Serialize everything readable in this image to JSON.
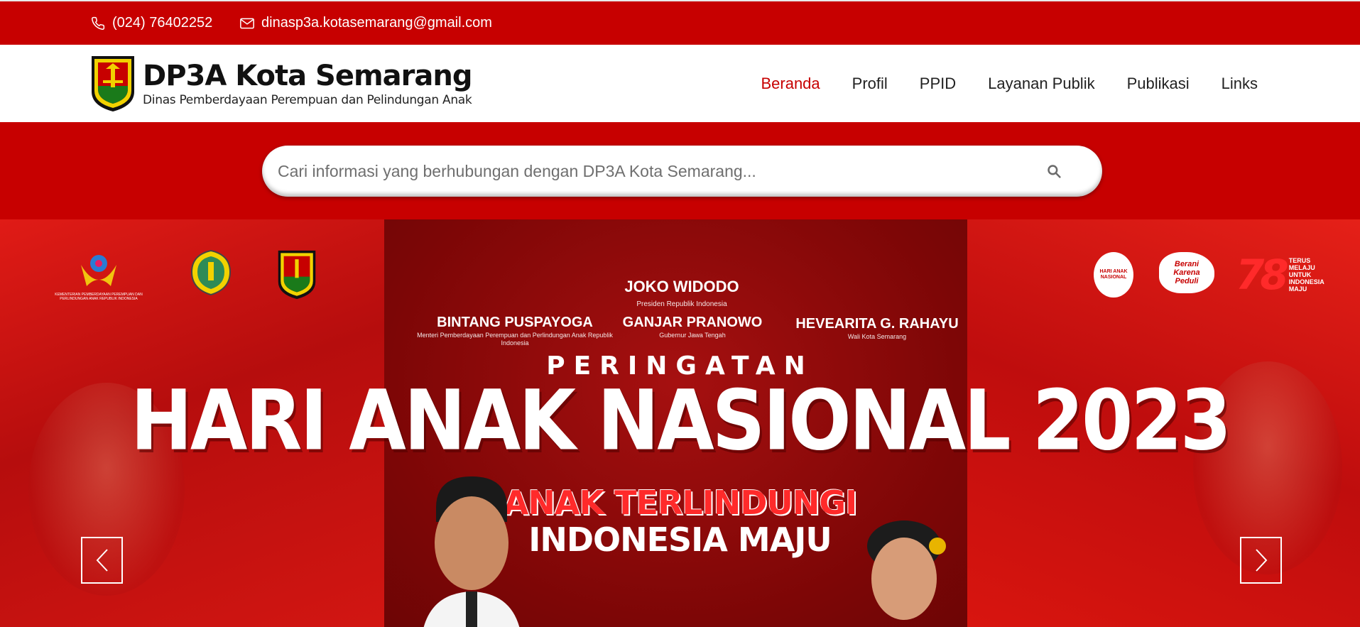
{
  "topbar": {
    "phone": "(024) 76402252",
    "email": "dinasp3a.kotasemarang@gmail.com",
    "phone_icon": "phone-icon",
    "email_icon": "envelope-icon"
  },
  "header": {
    "title": "DP3A Kota Semarang",
    "subtitle": "Dinas Pemberdayaan Perempuan dan Pelindungan Anak"
  },
  "nav": {
    "items": [
      {
        "label": "Beranda",
        "active": true
      },
      {
        "label": "Profil",
        "active": false
      },
      {
        "label": "PPID",
        "active": false
      },
      {
        "label": "Layanan Publik",
        "active": false
      },
      {
        "label": "Publikasi",
        "active": false
      },
      {
        "label": "Links",
        "active": false
      }
    ]
  },
  "search": {
    "placeholder": "Cari informasi yang berhubungan dengan DP3A Kota Semarang...",
    "value": "",
    "icon": "search-icon"
  },
  "banner": {
    "officials": [
      {
        "name": "JOKO WIDODO",
        "role": "Presiden Republik Indonesia"
      },
      {
        "name": "BINTANG PUSPAYOGA",
        "role": "Menteri Pemberdayaan Perempuan dan Perlindungan Anak Republik Indonesia"
      },
      {
        "name": "GANJAR PRANOWO",
        "role": "Gubernur Jawa Tengah"
      },
      {
        "name": "HEVEARITA G. RAHAYU",
        "role": "Wali Kota Semarang"
      }
    ],
    "pre_title": "PERINGATAN",
    "headline": "HARI ANAK NASIONAL 2023",
    "tagline_1": "ANAK TERLINDUNGI",
    "tagline_2": "INDONESIA MAJU",
    "kemenpppa_caption": "KEMENTERIAN PEMBERDAYAAN PEREMPUAN DAN PERLINDUNGAN ANAK REPUBLIK INDONESIA",
    "han_logo_text": "HARI ANAK NASIONAL",
    "berani_text": "Berani Karena Peduli",
    "hut_number": "78",
    "hut_text": "TERUS MELAJU UNTUK INDONESIA MAJU"
  },
  "carousel": {
    "prev_icon": "chevron-left-icon",
    "next_icon": "chevron-right-icon"
  },
  "colors": {
    "brand_red": "#c70000",
    "active_nav": "#c70000"
  }
}
